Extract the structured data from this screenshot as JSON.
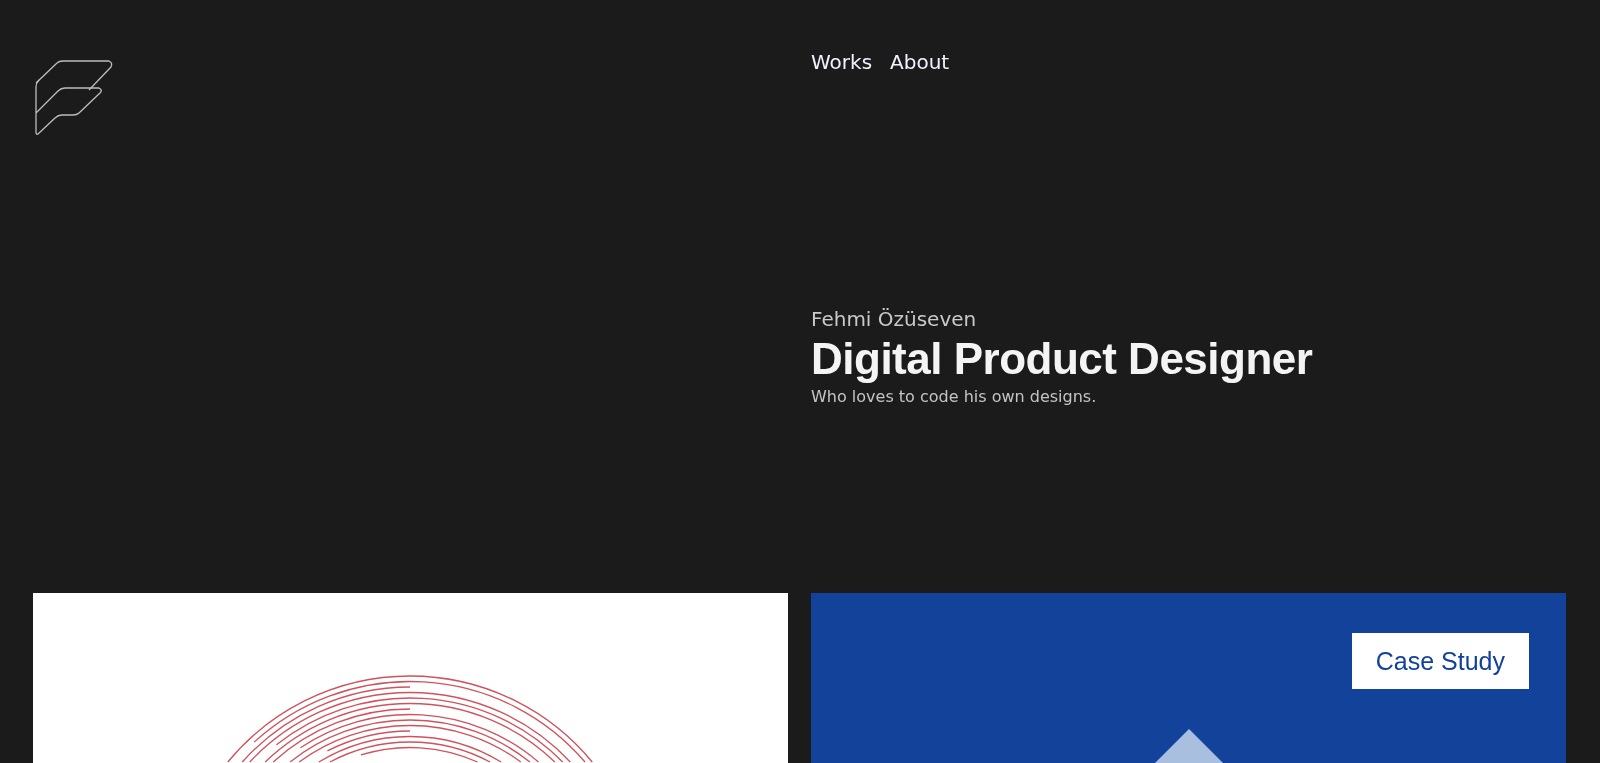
{
  "nav": [
    {
      "label": "Works"
    },
    {
      "label": "About"
    }
  ],
  "hero": {
    "name": "Fehmi Özüseven",
    "title": "Digital Product Designer",
    "tagline": "Who loves to code his own designs."
  },
  "works": [
    {
      "kind": "rings"
    },
    {
      "kind": "diamond",
      "button": "Case Study"
    }
  ]
}
